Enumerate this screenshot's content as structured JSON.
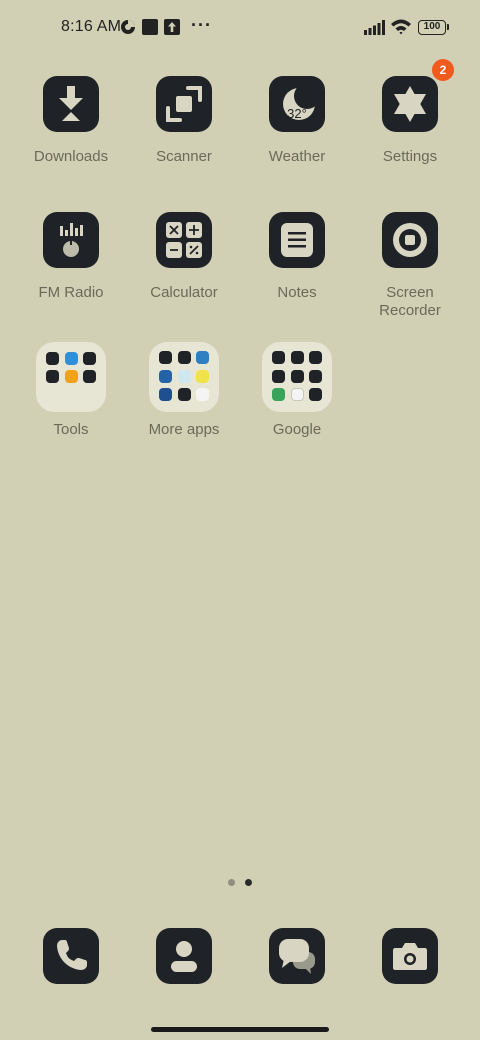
{
  "status_bar": {
    "time": "8:16 AM",
    "battery": "100",
    "overflow": "···"
  },
  "apps": [
    {
      "label": "Downloads",
      "icon": "download-icon"
    },
    {
      "label": "Scanner",
      "icon": "scanner-icon"
    },
    {
      "label": "Weather",
      "icon": "weather-icon",
      "temperature": "32°"
    },
    {
      "label": "Settings",
      "icon": "settings-icon",
      "badge": "2"
    },
    {
      "label": "FM Radio",
      "icon": "radio-icon"
    },
    {
      "label": "Calculator",
      "icon": "calculator-icon"
    },
    {
      "label": "Notes",
      "icon": "notes-icon"
    },
    {
      "label": "Screen Recorder",
      "icon": "record-icon"
    }
  ],
  "folders": [
    {
      "label": "Tools"
    },
    {
      "label": "More apps"
    },
    {
      "label": "Google"
    }
  ],
  "dock": [
    {
      "icon": "phone-icon"
    },
    {
      "icon": "contacts-icon"
    },
    {
      "icon": "messages-icon"
    },
    {
      "icon": "camera-icon"
    }
  ],
  "pages": {
    "count": 2,
    "current": 2
  },
  "colors": {
    "background": "#d1d0b5",
    "icon_tile": "#1f2227",
    "icon_glyph": "#d8d6c2",
    "label": "#6b6a58",
    "badge": "#f05a1c",
    "folder": "#e7e6d4"
  }
}
